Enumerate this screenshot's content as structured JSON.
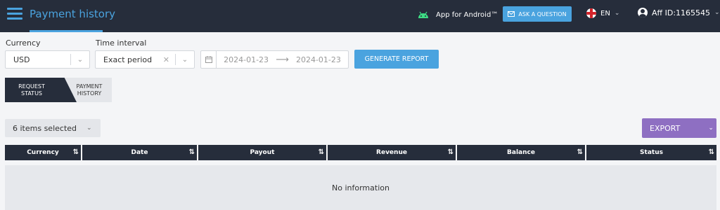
{
  "header": {
    "title": "Payment history",
    "android_label": "App for Android™",
    "ask_label": "ASK A QUESTION",
    "lang": "EN",
    "aff_id": "Aff ID:1165545"
  },
  "filters": {
    "currency_label": "Currency",
    "currency_value": "USD",
    "interval_label": "Time interval",
    "interval_value": "Exact period",
    "date_from": "2024-01-23",
    "date_to": "2024-01-23",
    "generate_label": "GENERATE REPORT"
  },
  "tabs": [
    {
      "line1": "REQUEST",
      "line2": "STATUS",
      "active": true
    },
    {
      "line1": "PAYMENT",
      "line2": "HISTORY",
      "active": false
    }
  ],
  "toolbar": {
    "items_selected": "6 items selected",
    "export_label": "EXPORT"
  },
  "table": {
    "columns": [
      "Currency",
      "Date",
      "Payout",
      "Revenue",
      "Balance",
      "Status"
    ],
    "empty_text": "No information"
  },
  "colors": {
    "topbar": "#262d3b",
    "accent": "#4aa3df",
    "export": "#8e6fc2"
  },
  "icons": {
    "menu": "hamburger-icon",
    "android": "android-icon",
    "mail": "mail-icon",
    "flag": "uk-flag-icon",
    "user": "user-icon",
    "calendar": "calendar-icon",
    "sort": "sort-icon"
  }
}
